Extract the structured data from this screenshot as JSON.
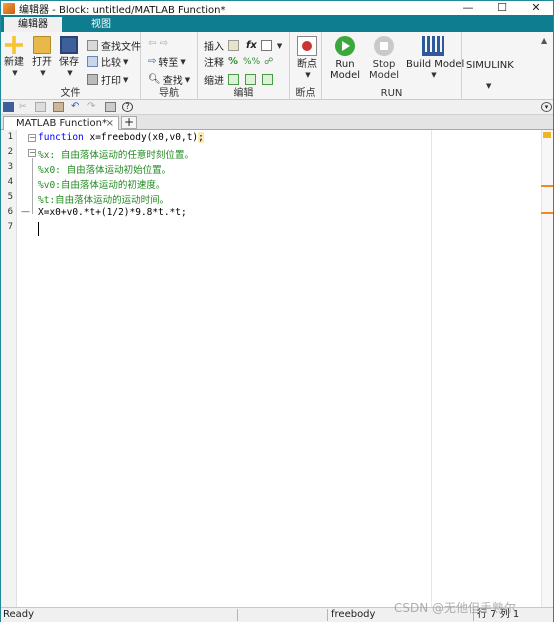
{
  "window": {
    "title": "编辑器 - Block: untitled/MATLAB Function*",
    "controls": [
      "—",
      "☐",
      "✕"
    ]
  },
  "ribbon_tabs": [
    {
      "label": "编辑器"
    },
    {
      "label": "视图"
    }
  ],
  "ribbon": {
    "file": {
      "label": "文件",
      "new": "新建",
      "open": "打开",
      "save": "保存",
      "find_files": "查找文件",
      "compare": "比较",
      "print": "打印"
    },
    "navigate": {
      "label": "导航",
      "goto": "转至",
      "find": "查找"
    },
    "edit": {
      "label": "编辑",
      "insert": "插入",
      "comment": "注释",
      "indent": "缩进",
      "fx": "fx"
    },
    "breakpoints": {
      "label": "断点",
      "btn": "断点"
    },
    "run": {
      "label": "RUN",
      "run_model": "Run Model",
      "stop_model": "Stop Model",
      "build_model": "Build Model"
    },
    "simulink": {
      "label": "SIMULINK"
    }
  },
  "editor": {
    "tab_label": "MATLAB Function*",
    "tab_close": "×",
    "add_tab": "+",
    "lines": [
      {
        "num": "1",
        "marker": "",
        "text": "function x=freebody(x0,v0,t);"
      },
      {
        "num": "2",
        "marker": "",
        "text": "%x: 自由落体运动的任意时刻位置。"
      },
      {
        "num": "3",
        "marker": "",
        "text": "%x0: 自由落体运动初始位置。"
      },
      {
        "num": "4",
        "marker": "",
        "text": "%v0:自由落体运动的初速度。"
      },
      {
        "num": "5",
        "marker": "",
        "text": "%t:自由落体运动的运动时间。"
      },
      {
        "num": "6",
        "marker": "—",
        "text": "X=x0+v0.*t+(1/2)*9.8*t.*t;"
      },
      {
        "num": "7",
        "marker": "",
        "text": ""
      }
    ],
    "keyword": "function",
    "line1_rest": " x=freebody(x0,v0,t)",
    "line1_semicolon": ";"
  },
  "status": {
    "ready": "Ready",
    "function_name": "freebody",
    "position": "行 7    列 1"
  },
  "watermark": "CSDN @无他但手熟尔",
  "colors": {
    "tab_bar": "#0e7d8f",
    "keyword": "#0000ff",
    "comment": "#228b22",
    "run_green": "#3aa83a"
  }
}
